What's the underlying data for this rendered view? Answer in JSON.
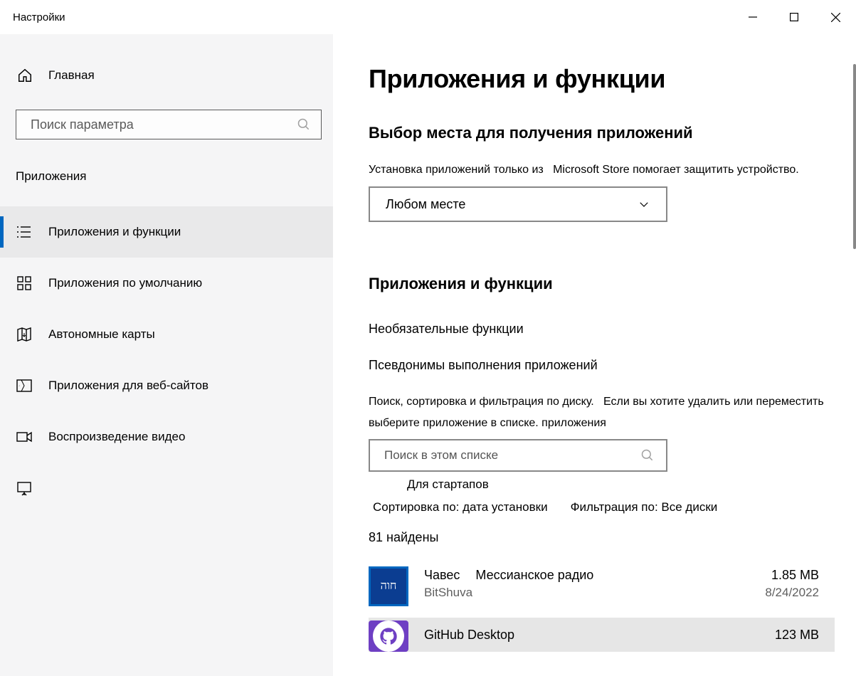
{
  "window": {
    "title": "Настройки"
  },
  "sidebar": {
    "home": "Главная",
    "search_placeholder": "Поиск параметра",
    "section": "Приложения",
    "items": [
      {
        "label": "Приложения и функции"
      },
      {
        "label": "Приложения по умолчанию"
      },
      {
        "label": "Автономные карты"
      },
      {
        "label": "Приложения для веб-сайтов"
      },
      {
        "label": "Воспроизведение видео"
      }
    ]
  },
  "main": {
    "title": "Приложения и функции",
    "source_section": {
      "heading": "Выбор места для получения приложений",
      "desc_a": "Установка приложений только из",
      "desc_b": "Microsoft Store помогает защитить устройство.",
      "dropdown": "Любом месте"
    },
    "apps_section": {
      "heading": "Приложения и функции",
      "optional": "Необязательные функции",
      "aliases": "Псевдонимы выполнения приложений",
      "hint1": "Поиск, сортировка и фильтрация по диску.",
      "hint2": "Если вы хотите удалить или переместить",
      "hint3": "выберите приложение в списке. приложения",
      "search_placeholder": "Поиск в этом списке",
      "startup": "Для стартапов",
      "sort": "Сортировка по: дата установки",
      "filter": "Фильтрация по: Все диски",
      "found_count": "81",
      "found_label": "найдены"
    },
    "apps": [
      {
        "name": "Чавес",
        "extra": "Мессианское радио",
        "publisher": "BitShuva",
        "size": "1.85 MB",
        "date": "8/24/2022",
        "tile_text": "חוה"
      },
      {
        "name": "GitHub Desktop",
        "extra": "",
        "publisher": "",
        "size": "123 MB",
        "date": ""
      }
    ]
  }
}
